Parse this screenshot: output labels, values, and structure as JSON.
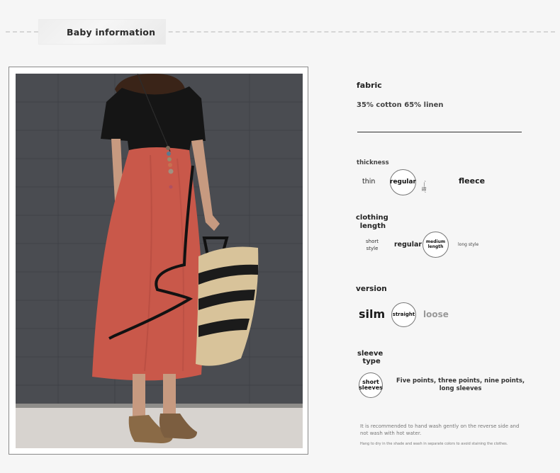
{
  "header": {
    "title": "Baby information"
  },
  "fabric": {
    "label": "fabric",
    "value": "35% cotton 65% linen"
  },
  "thickness": {
    "label": "thickness",
    "options": [
      "thin",
      "regular",
      "‘一般’",
      "fleece"
    ],
    "selected": "regular"
  },
  "clothing_length": {
    "label_1": "clothing",
    "label_2": "length",
    "options": {
      "short_1": "short",
      "short_2": "style",
      "regular": "regular",
      "medium_1": "medium",
      "medium_2": "length",
      "long": "long style"
    },
    "selected": "medium length"
  },
  "version": {
    "label": "version",
    "options": [
      "silm",
      "straight",
      "loose"
    ],
    "selected": "straight"
  },
  "sleeve_type": {
    "label_1": "sleeve",
    "label_2": "type",
    "options": {
      "short_1": "short",
      "short_2": "sleeves",
      "other_1": "Five points, three points, nine points,",
      "other_2": "long sleeves"
    },
    "selected": "short sleeves"
  },
  "care": {
    "line_1": "It is recommended to hand wash gently on the reverse side and",
    "line_2": "not wash with hot water.",
    "line_3": "Hang to dry in the shade and wash in separate colors to avoid staining the clothes."
  },
  "colors": {
    "dress": "#c9584a",
    "bodice": "#151515",
    "wall": "#4a4c51",
    "floor": "#d7d3cf",
    "bag_straw": "#d8c39a"
  }
}
